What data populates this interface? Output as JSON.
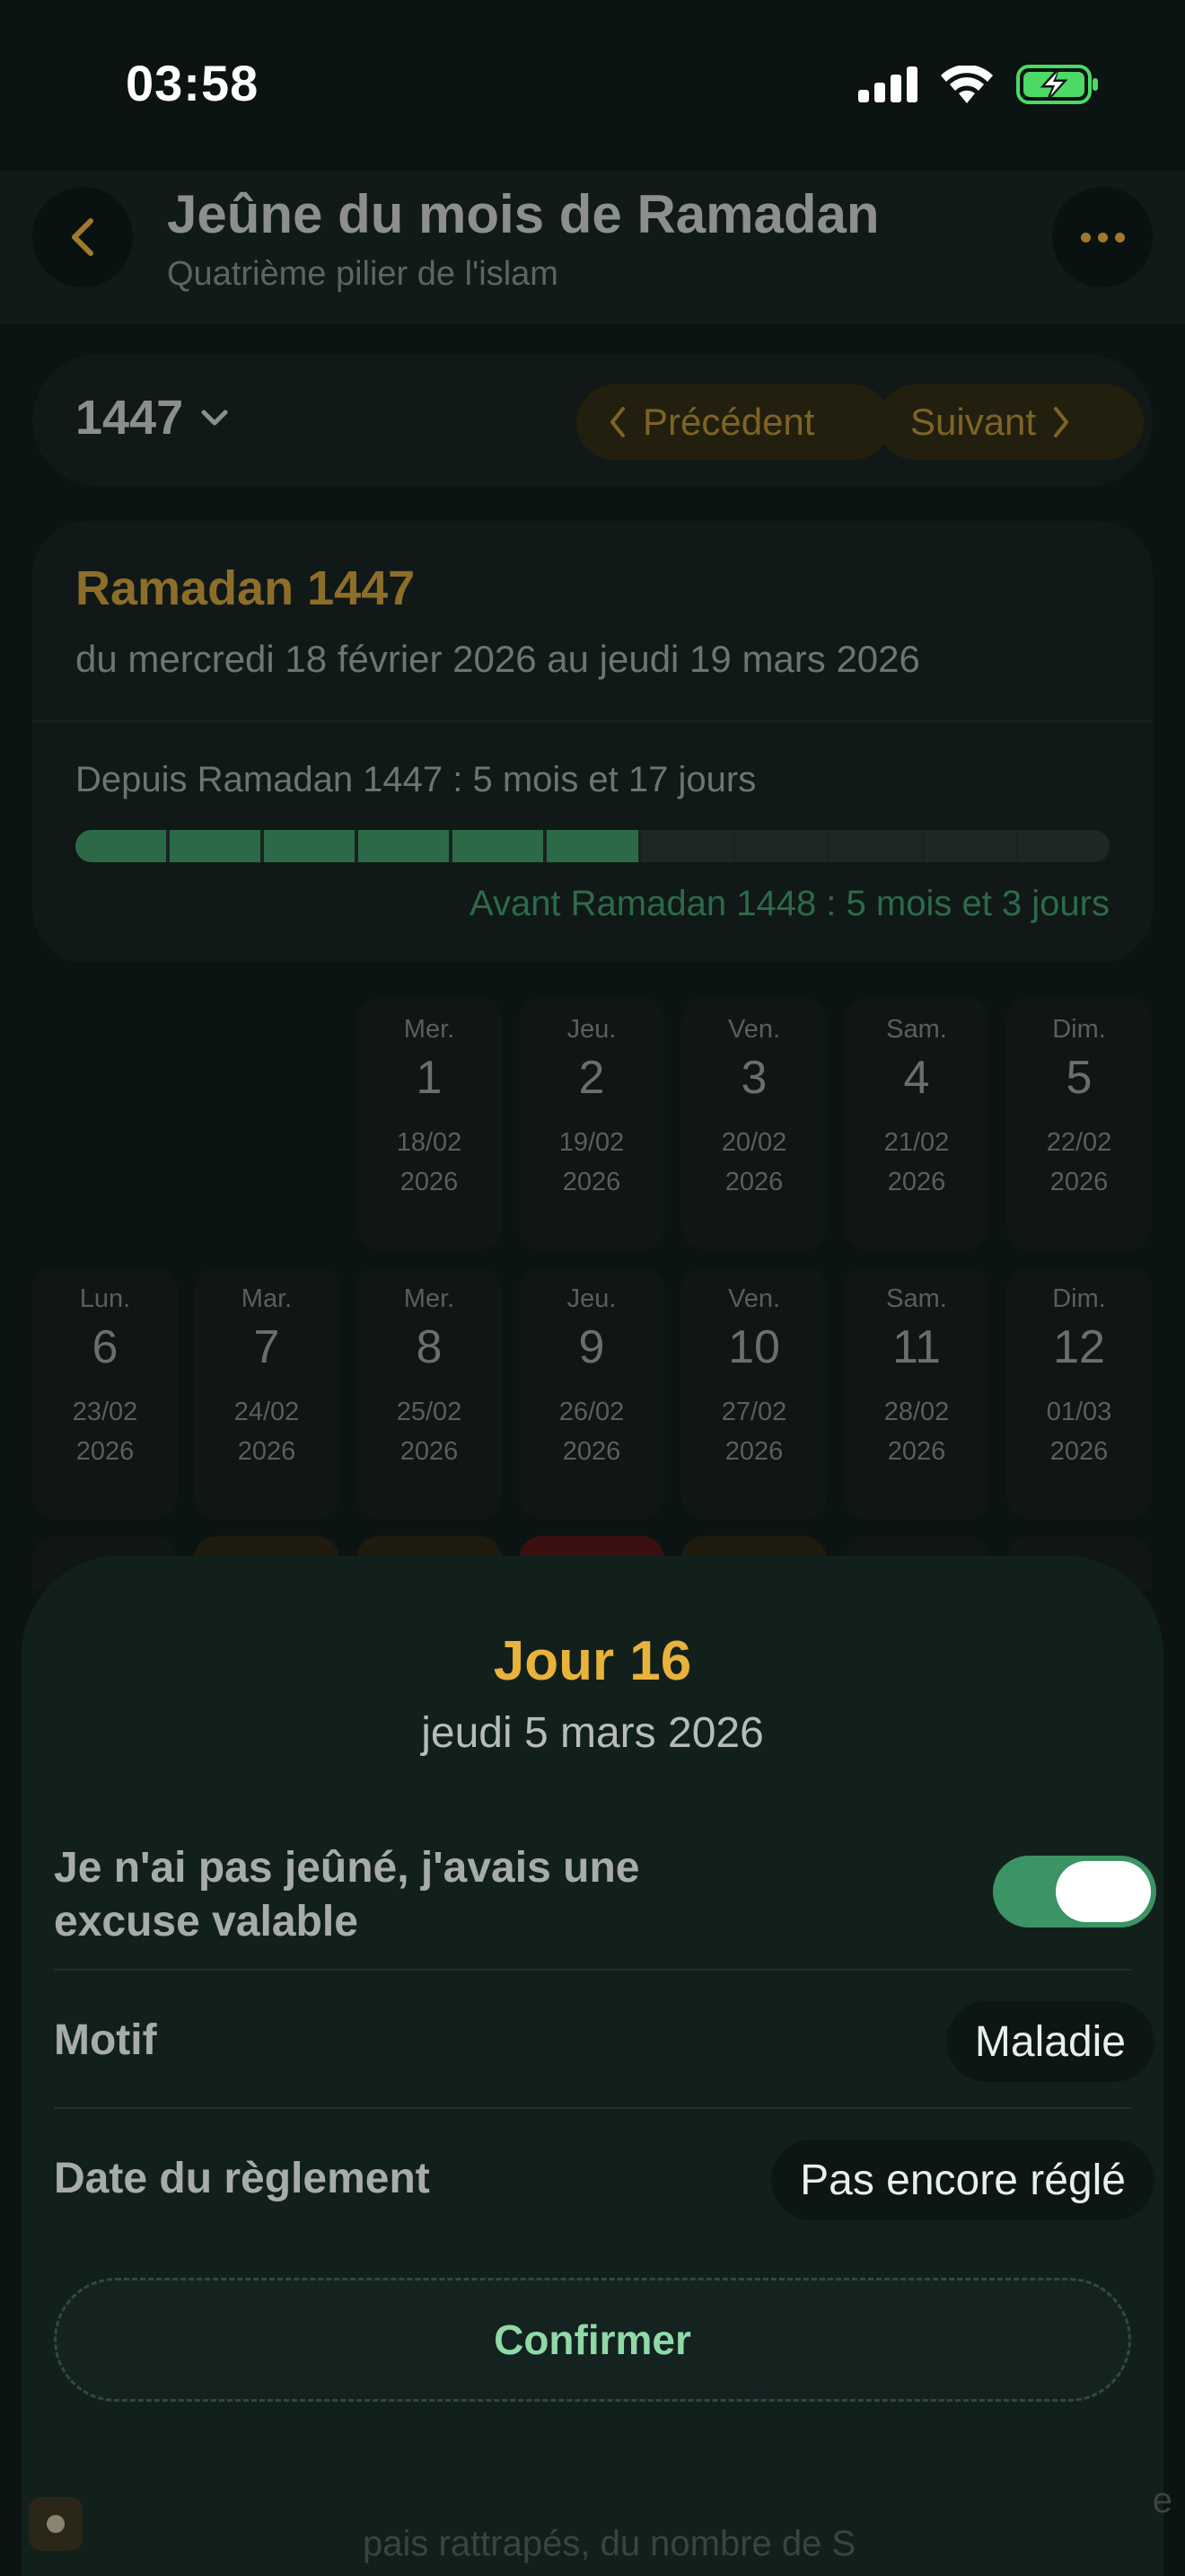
{
  "status": {
    "time": "03:58"
  },
  "header": {
    "title": "Jeûne du mois de Ramadan",
    "subtitle": "Quatrième pilier de l'islam",
    "back_icon": "chevron-left-icon",
    "more_icon": "ellipsis-icon"
  },
  "year_selector": {
    "year": "1447",
    "prev_label": "Précédent",
    "next_label": "Suivant"
  },
  "ramadan_card": {
    "title": "Ramadan 1447",
    "range": "du mercredi 18 février 2026 au jeudi 19 mars 2026",
    "since": "Depuis Ramadan 1447 : 5 mois et 17 jours",
    "before": "Avant Ramadan 1448 : 5 mois et 3 jours",
    "progress_segments_total": 11,
    "progress_segments_filled": 6
  },
  "calendar": {
    "week1": [
      {
        "name": "Mer.",
        "num": "1",
        "date": "18/02",
        "year": "2026"
      },
      {
        "name": "Jeu.",
        "num": "2",
        "date": "19/02",
        "year": "2026"
      },
      {
        "name": "Ven.",
        "num": "3",
        "date": "20/02",
        "year": "2026"
      },
      {
        "name": "Sam.",
        "num": "4",
        "date": "21/02",
        "year": "2026"
      },
      {
        "name": "Dim.",
        "num": "5",
        "date": "22/02",
        "year": "2026"
      }
    ],
    "week2": [
      {
        "name": "Lun.",
        "num": "6",
        "date": "23/02",
        "year": "2026"
      },
      {
        "name": "Mar.",
        "num": "7",
        "date": "24/02",
        "year": "2026"
      },
      {
        "name": "Mer.",
        "num": "8",
        "date": "25/02",
        "year": "2026"
      },
      {
        "name": "Jeu.",
        "num": "9",
        "date": "26/02",
        "year": "2026"
      },
      {
        "name": "Ven.",
        "num": "10",
        "date": "27/02",
        "year": "2026"
      },
      {
        "name": "Sam.",
        "num": "11",
        "date": "28/02",
        "year": "2026"
      },
      {
        "name": "Dim.",
        "num": "12",
        "date": "01/03",
        "year": "2026"
      }
    ]
  },
  "sheet": {
    "title": "Jour 16",
    "date": "jeudi 5 mars 2026",
    "excuse_label_line1": "Je n'ai pas jeûné, j'avais une",
    "excuse_label_line2": "excuse valable",
    "excuse_on": true,
    "motif_label": "Motif",
    "motif_value": "Maladie",
    "reglement_label": "Date du règlement",
    "reglement_value": "Pas encore réglé",
    "confirm_label": "Confirmer"
  },
  "footer": {
    "text": "pais rattrapés, du nombre de S",
    "right": "e"
  },
  "colors": {
    "accent_gold": "#e8b23c",
    "accent_green": "#3a9463",
    "background": "#0b1412"
  }
}
